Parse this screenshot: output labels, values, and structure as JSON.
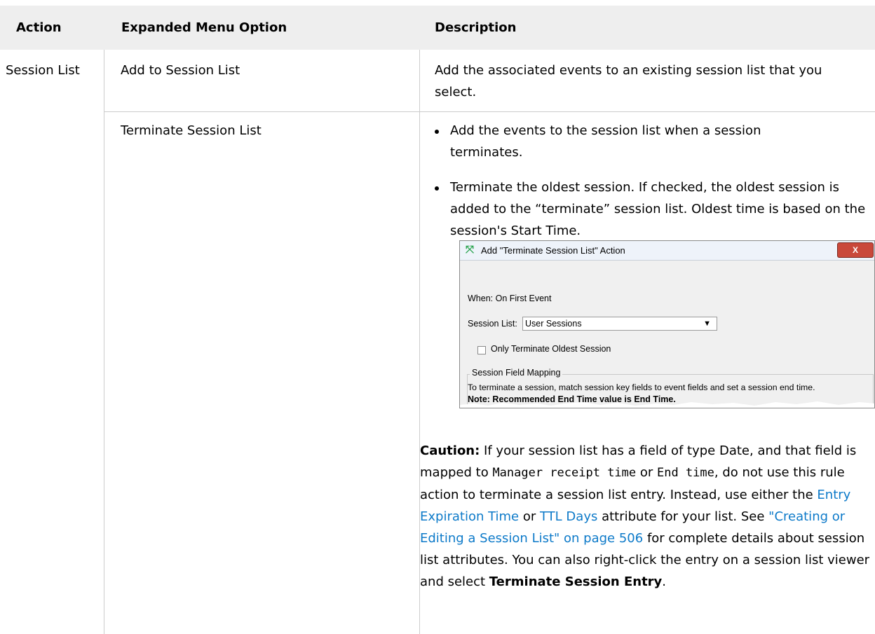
{
  "headers": {
    "action": "Action",
    "menu_option": "Expanded Menu Option",
    "description": "Description"
  },
  "rows": {
    "action": "Session List",
    "add_option": "Add to Session List",
    "add_desc": "Add the associated events to an existing session list that you select.",
    "terminate_option": "Terminate Session List",
    "bullet1": "Add the events to the session list when a session terminates.",
    "bullet2": "Terminate the oldest session. If checked, the oldest session is added to the “terminate” session list. Oldest time is based on the session's Start Time."
  },
  "dialog": {
    "title": "Add \"Terminate Session List\" Action",
    "close": "X",
    "when": "When: On First Event",
    "session_list_label": "Session List:",
    "session_list_value": "User Sessions",
    "checkbox_label": "Only Terminate Oldest Session",
    "group_label": "Session Field Mapping",
    "mapping_text": "To terminate a session, match session key fields to event fields and set a session end time.",
    "note": "Note: Recommended End Time value is End Time."
  },
  "caution": {
    "label": "Caution:",
    "t1": " If your session list has a field of type Date, and that field is mapped to ",
    "code1": "Manager receipt time",
    "t2": " or ",
    "code2": "End time",
    "t3": ", do not use this rule action to terminate a session list entry. Instead, use either the ",
    "link1": "Entry Expiration Time",
    "t4": " or ",
    "link2": "TTL Days",
    "t5": " attribute for your list. See ",
    "link3": "\"Creating or Editing a Session List\" on page 506",
    "t6": " for complete details about session list attributes. You can also right-click the entry on a session list viewer and select ",
    "bold_end": "Terminate Session Entry",
    "t7": "."
  },
  "colors": {
    "header_bg": "#eeeeee",
    "grid": "#cccccc",
    "link": "#0d7ac9"
  }
}
